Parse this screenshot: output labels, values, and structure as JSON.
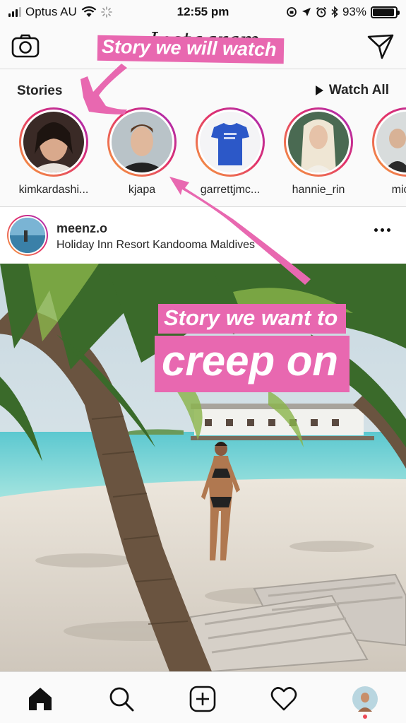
{
  "status_bar": {
    "carrier": "Optus AU",
    "time": "12:55 pm",
    "battery_text": "93%",
    "battery_level": 0.93,
    "icons": [
      "signal-icon",
      "wifi-icon",
      "loading-icon",
      "orientation-lock-icon",
      "location-icon",
      "alarm-icon",
      "bluetooth-icon",
      "battery-icon"
    ]
  },
  "nav": {
    "logo_text": "Instagram",
    "left_icon": "camera-icon",
    "right_icon": "direct-message-icon"
  },
  "annotations": {
    "top_label": "Story we will watch",
    "middle_label": "Story we want to",
    "big_label": "creep on",
    "color": "#e868b0"
  },
  "stories": {
    "title": "Stories",
    "watch_all": "Watch All",
    "items": [
      {
        "name": "kimkardashi..."
      },
      {
        "name": "kjapa"
      },
      {
        "name": "garrettjmc..."
      },
      {
        "name": "hannie_rin"
      },
      {
        "name": "micah"
      }
    ]
  },
  "post": {
    "username": "meenz.o",
    "location": "Holiday Inn Resort Kandooma Maldives"
  },
  "tab_bar": {
    "items": [
      "home-icon",
      "search-icon",
      "add-post-icon",
      "activity-heart-icon",
      "profile-avatar"
    ]
  },
  "colors": {
    "story_ring_start": "#f7a43a",
    "story_ring_mid": "#e1306c",
    "story_ring_end": "#a02ac0",
    "notification_dot": "#ed4956"
  }
}
